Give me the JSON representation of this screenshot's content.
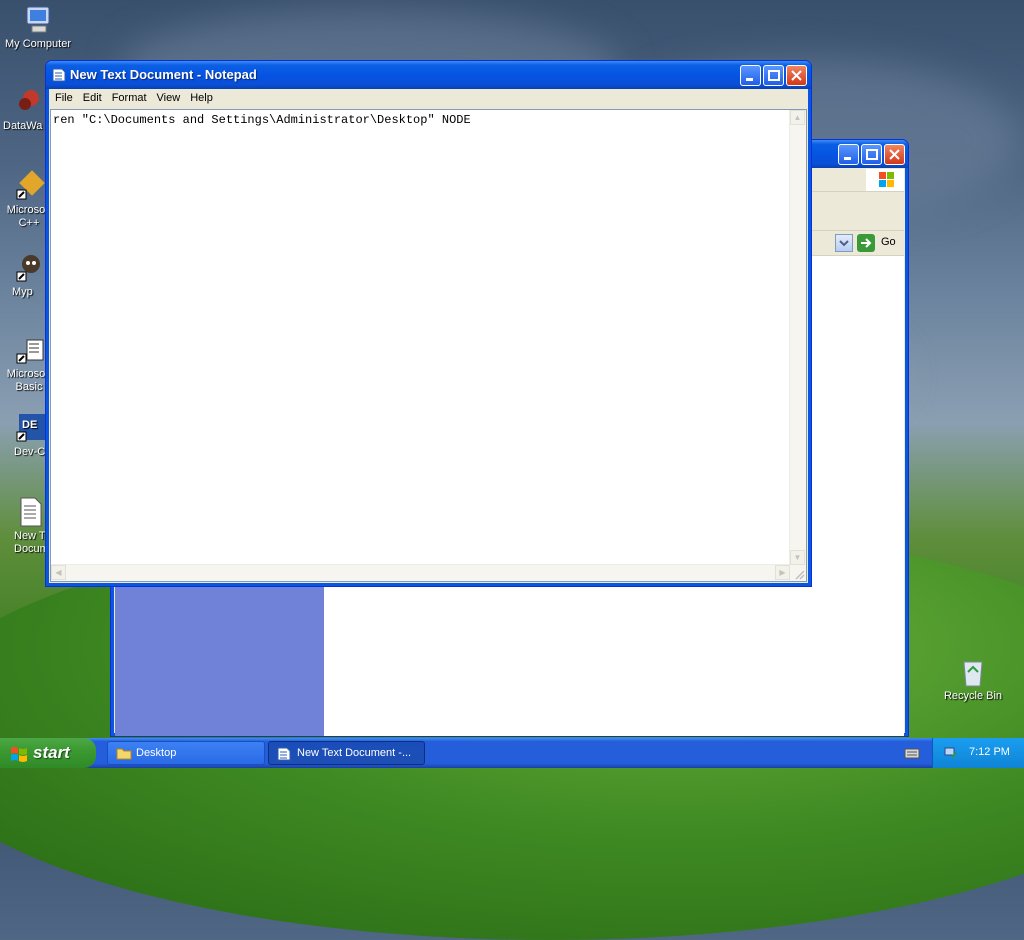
{
  "desktop": {
    "icons": [
      {
        "label": "My Computer",
        "icon": "computer-icon"
      },
      {
        "label": "DataWa",
        "icon": "datawarehouse-icon"
      },
      {
        "label": "Microsoft\nC++",
        "icon": "cpp-shortcut-icon"
      },
      {
        "label": "Myp",
        "icon": "app-shortcut-icon"
      },
      {
        "label": "Microsoft\nBasic",
        "icon": "basic-shortcut-icon"
      },
      {
        "label": "Dev-C",
        "icon": "devcpp-shortcut-icon"
      },
      {
        "label": "New T\nDocum",
        "icon": "text-document-icon"
      },
      {
        "label": "Recycle Bin",
        "icon": "recycle-bin-icon"
      }
    ]
  },
  "explorer": {
    "go_label": "Go"
  },
  "notepad": {
    "title": "New Text Document - Notepad",
    "menu": [
      "File",
      "Edit",
      "Format",
      "View",
      "Help"
    ],
    "content": "ren \"C:\\Documents and Settings\\Administrator\\Desktop\" NODE"
  },
  "taskbar": {
    "start_label": "start",
    "items": [
      {
        "label": "Desktop",
        "icon": "folder-icon"
      },
      {
        "label": "New Text Document -...",
        "icon": "notepad-icon"
      }
    ],
    "clock": "7:12 PM"
  },
  "colors": {
    "titlebar": "#0554e3",
    "taskbar": "#245edb",
    "start": "#3c9a32",
    "close": "#d2371b"
  }
}
